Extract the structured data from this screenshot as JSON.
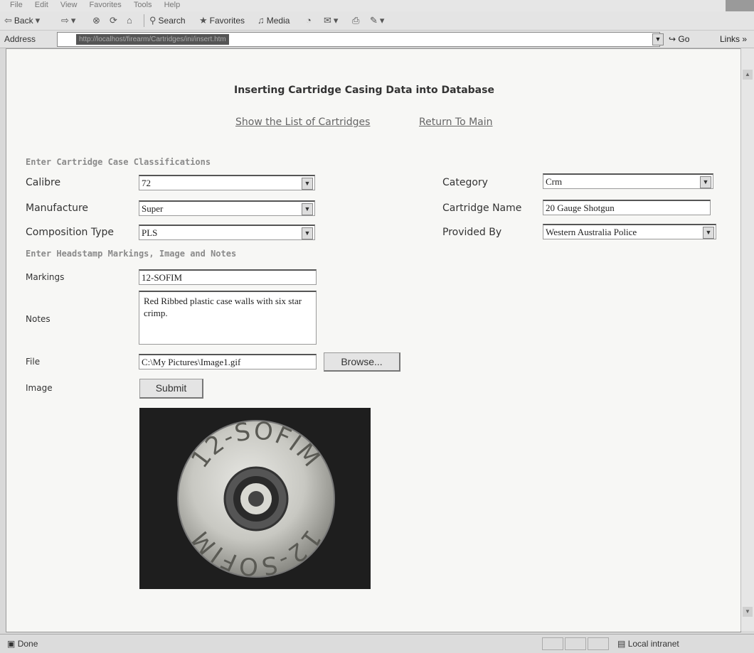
{
  "browser": {
    "menu": [
      "File",
      "Edit",
      "View",
      "Favorites",
      "Tools",
      "Help"
    ],
    "toolbar": {
      "back": "Back",
      "search": "Search",
      "favorites": "Favorites",
      "media": "Media"
    },
    "address_label": "Address",
    "address_url": "http://localhost/firearm/Cartridges/ini/insert.htm",
    "go_label": "Go",
    "links_label": "Links »"
  },
  "page": {
    "title": "Inserting Cartridge Casing Data into Database",
    "links": {
      "show_list": "Show the List of Cartridges",
      "return_main": "Return To Main"
    },
    "section1": "Enter Cartridge Case Classifications",
    "section2": "Enter Headstamp Markings, Image and Notes",
    "fields": {
      "calibre_label": "Calibre",
      "calibre_value": "72",
      "manufacture_label": "Manufacture",
      "manufacture_value": "Super",
      "composition_label": "Composition Type",
      "composition_value": "PLS",
      "category_label": "Category",
      "category_value": "Crm",
      "cartridge_name_label": "Cartridge Name",
      "cartridge_name_value": "20 Gauge Shotgun",
      "provided_by_label": "Provided By",
      "provided_by_value": "Western Australia Police",
      "markings_label": "Markings",
      "markings_value": "12-SOFIM",
      "notes_label": "Notes",
      "notes_value": "Red Ribbed plastic case walls with six star crimp.",
      "file_label": "File",
      "file_value": "C:\\My Pictures\\Image1.gif",
      "image_label": "Image"
    },
    "buttons": {
      "browse": "Browse...",
      "submit": "Submit"
    },
    "headstamp": {
      "text_top": "12-SOFIM",
      "text_bottom": "12-SOFIM"
    }
  },
  "status": {
    "left": "Done",
    "zone": "Local intranet"
  }
}
